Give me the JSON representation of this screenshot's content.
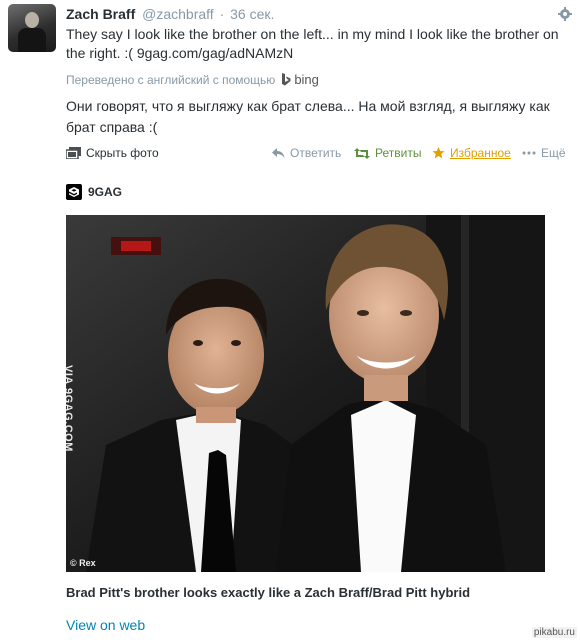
{
  "tweet": {
    "author_name": "Zach Braff",
    "author_handle": "@zachbraff",
    "separator": "·",
    "time": "36 сек.",
    "text_line1": "They say I look like the brother on the left... in my mind I look like the brother on",
    "text_line2_prefix": "the right. :( ",
    "link": "9gag.com/gag/adNAMzN"
  },
  "translation": {
    "label": "Переведено с английский с помощью",
    "provider": "bing",
    "text": "Они говорят, что я выгляжу как брат слева... На мой взгляд, я выгляжу как брат справа :("
  },
  "actions": {
    "hide_photo": "Скрыть фото",
    "reply": "Ответить",
    "retweet": "Ретвиты",
    "favorite": "Избранное",
    "more": "Ещё"
  },
  "card": {
    "source": "9GAG",
    "watermark": "VIA 9GAG.COM",
    "credit": "© Rex",
    "caption": "Brad Pitt's brother looks exactly like a Zach Braff/Brad Pitt hybrid",
    "view_on_web": "View on web"
  },
  "site_mark": "pikabu.ru",
  "colors": {
    "link_blue": "#0084b4",
    "retweet_green": "#5c913b",
    "favorite_gold": "#e1a000",
    "muted_gray": "#8899a6"
  },
  "icons": [
    "gear-icon",
    "photo-icon",
    "reply-icon",
    "retweet-icon",
    "star-icon",
    "ellipsis-icon",
    "bing-icon",
    "9gag-logo-icon"
  ]
}
